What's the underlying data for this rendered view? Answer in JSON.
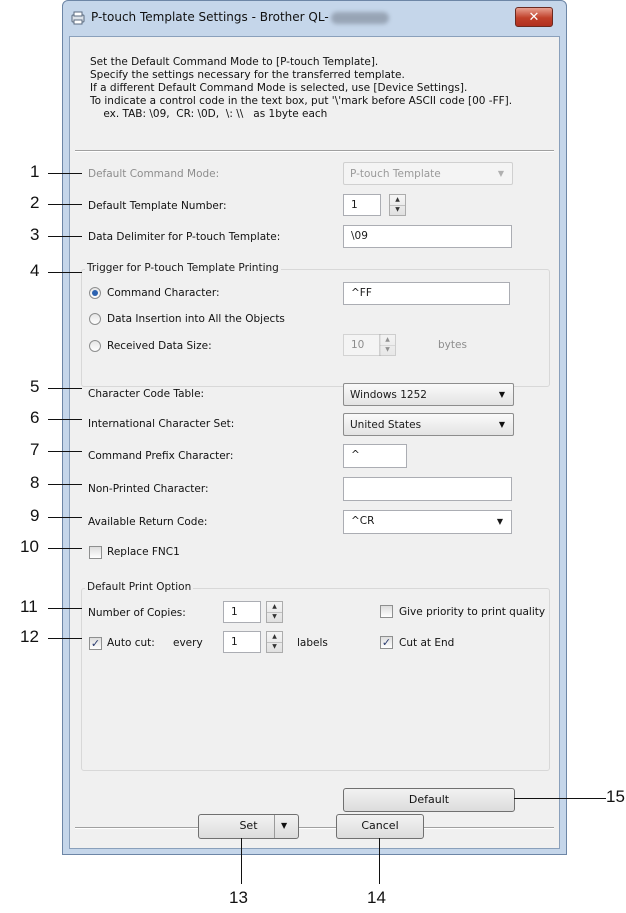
{
  "window": {
    "title": "P-touch Template Settings - Brother QL-",
    "close_glyph": "✕"
  },
  "description": {
    "lines": [
      "Set the Default Command Mode to [P-touch Template].",
      "Specify the settings necessary for the transferred template.",
      "If a different Default Command Mode is selected, use [Device Settings].",
      "To indicate a control code in the text box, put '\\'mark before ASCII code [00 -FF].",
      "    ex. TAB: \\09,  CR: \\0D,  \\: \\\\   as 1byte each"
    ]
  },
  "settings": {
    "default_command_mode": {
      "label": "Default Command Mode:",
      "value": "P-touch Template"
    },
    "default_template_number": {
      "label": "Default Template Number:",
      "value": "1"
    },
    "data_delimiter": {
      "label": "Data Delimiter for P-touch Template:",
      "value": "\\09"
    },
    "trigger": {
      "group_title": "Trigger for P-touch Template Printing",
      "command_character": {
        "label": "Command Character:",
        "value": "^FF",
        "selected": true
      },
      "data_insertion": {
        "label": "Data Insertion into All the Objects",
        "selected": false
      },
      "received_data_size": {
        "label": "Received Data Size:",
        "value": "10",
        "unit": "bytes",
        "selected": false
      }
    },
    "character_code_table": {
      "label": "Character Code Table:",
      "value": "Windows 1252"
    },
    "international_character_set": {
      "label": "International Character Set:",
      "value": "United States"
    },
    "command_prefix_character": {
      "label": "Command Prefix Character:",
      "value": "^"
    },
    "non_printed_character": {
      "label": "Non-Printed Character:",
      "value": ""
    },
    "available_return_code": {
      "label": "Available Return Code:",
      "value": "^CR"
    },
    "replace_fnc1": {
      "label": "Replace FNC1",
      "checked": false
    }
  },
  "print_option": {
    "group_title": "Default Print Option",
    "number_of_copies": {
      "label": "Number of Copies:",
      "value": "1"
    },
    "auto_cut": {
      "label": "Auto cut:",
      "checked": true,
      "every_label": "every",
      "value": "1",
      "unit": "labels"
    },
    "give_priority_quality": {
      "label": "Give priority to print quality",
      "checked": false
    },
    "cut_at_end": {
      "label": "Cut at End",
      "checked": true
    }
  },
  "buttons": {
    "default": "Default",
    "set": "Set",
    "cancel": "Cancel"
  },
  "glyphs": {
    "dropdown": "▼",
    "spin_up": "▲",
    "spin_down": "▼",
    "check": "✓"
  },
  "callouts": [
    "1",
    "2",
    "3",
    "4",
    "5",
    "6",
    "7",
    "8",
    "9",
    "10",
    "11",
    "12",
    "13",
    "14",
    "15"
  ]
}
